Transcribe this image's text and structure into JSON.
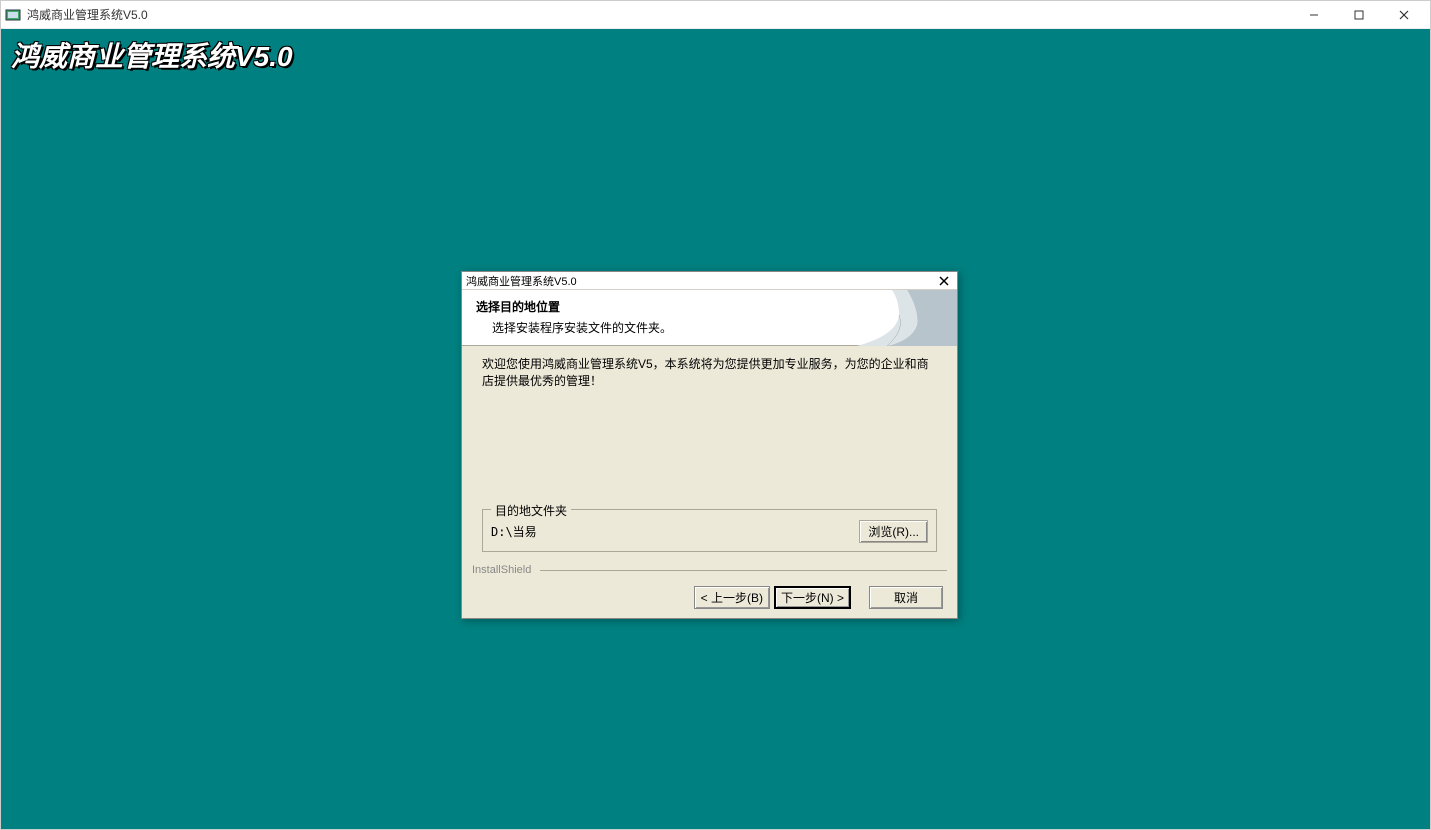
{
  "window": {
    "title": "鸿威商业管理系统V5.0"
  },
  "brand": "鸿威商业管理系统V5.0",
  "dialog": {
    "title": "鸿威商业管理系统V5.0",
    "header_title": "选择目的地位置",
    "header_subtitle": "选择安装程序安装文件的文件夹。",
    "welcome_text": "欢迎您使用鸿威商业管理系统V5，本系统将为您提供更加专业服务，为您的企业和商店提供最优秀的管理！",
    "destination": {
      "legend": "目的地文件夹",
      "path": "D:\\当易",
      "browse_label": "浏览(R)..."
    },
    "brand_label": "InstallShield",
    "buttons": {
      "back": "< 上一步(B)",
      "next": "下一步(N) >",
      "cancel": "取消"
    }
  }
}
